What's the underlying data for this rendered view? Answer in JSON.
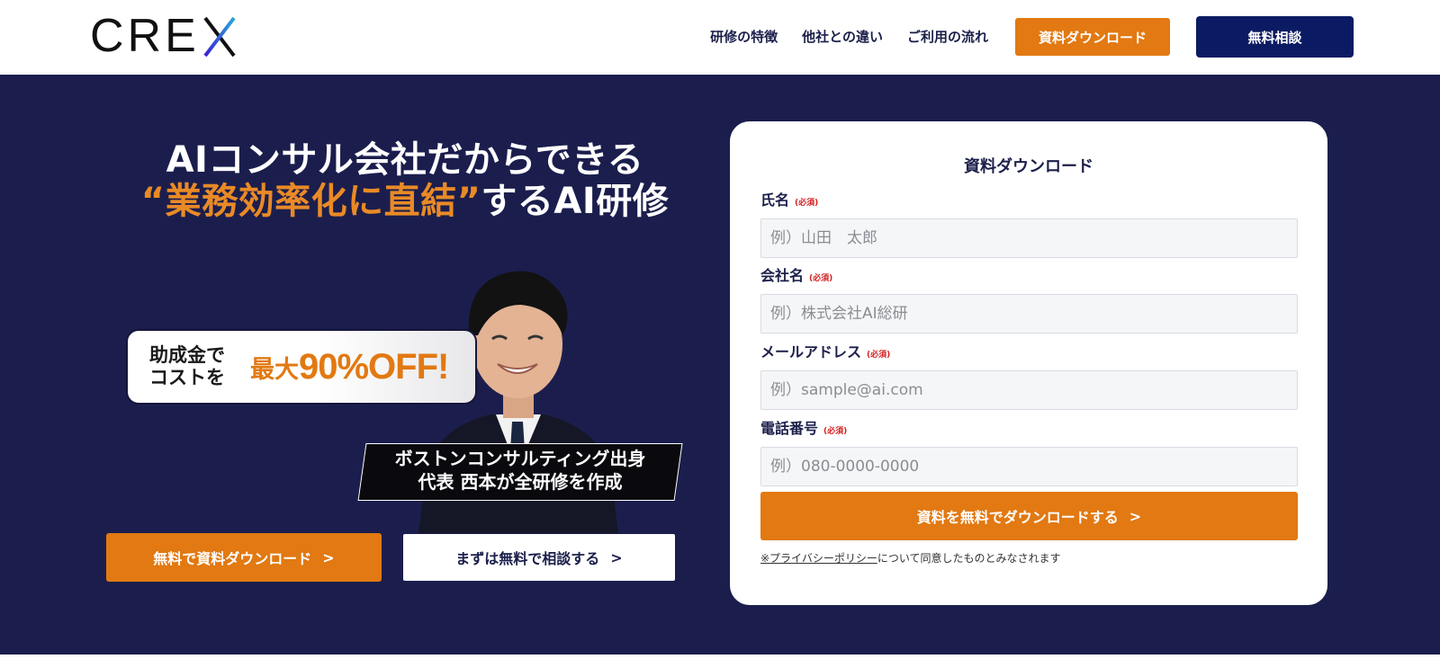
{
  "header": {
    "logo_text": "CRE",
    "logo_x": "X",
    "nav": [
      "研修の特徴",
      "他社との違い",
      "ご利用の流れ"
    ],
    "download_button": "資料ダウンロード",
    "consult_button": "無料相談"
  },
  "hero": {
    "headline_line1": "AIコンサル会社だからできる",
    "headline_orange": "“業務効率化に直結”",
    "headline_rest": "するAI研修",
    "subsidy_left": "助成金で\nコストを",
    "subsidy_max": "最大",
    "subsidy_big": "90%OFF!",
    "boston_text": "ボストンコンサルティング出身\n代表 西本が全研修を作成",
    "btn_download": "無料で資料ダウンロード",
    "btn_consult": "まずは無料で相談する",
    "chevron": ">"
  },
  "form": {
    "title": "資料ダウンロード",
    "required": "(必須)",
    "fields": [
      {
        "label": "氏名",
        "placeholder": "例）山田　太郎"
      },
      {
        "label": "会社名",
        "placeholder": "例）株式会社AI総研"
      },
      {
        "label": "メールアドレス",
        "placeholder": "例）sample@ai.com"
      },
      {
        "label": "電話番号",
        "placeholder": "例）080-0000-0000"
      }
    ],
    "submit": "資料を無料でダウンロードする",
    "chevron": ">",
    "privacy_link": "※プライバシーポリシー",
    "privacy_rest": "について同意したものとみなされます"
  },
  "colors": {
    "accent_orange": "#e27912",
    "navy": "#0b1b63",
    "hero_bg": "#1b1e4d"
  }
}
